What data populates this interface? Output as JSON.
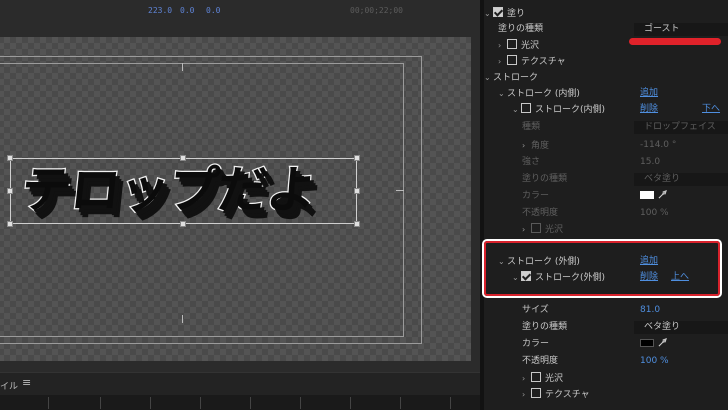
{
  "viewer": {
    "readout": [
      "223.0",
      "0.0",
      "0.0"
    ],
    "timecode": "00;00;22;00"
  },
  "canvas_text": "テロップだよ",
  "bottom": {
    "label": "イル",
    "menu": "≡"
  },
  "panel": {
    "fill_checkbox": "塗り",
    "fill_type_label": "塗りの種類",
    "fill_type_value": "ゴースト",
    "gloss": "光沢",
    "texture": "テクスチャ",
    "stroke_header": "ストローク",
    "inner_stroke_group": "ストローク (内側)",
    "add": "追加",
    "inner_stroke_item": "ストローク(内側)",
    "delete": "削除",
    "move_down": "下へ",
    "type_label": "種類",
    "type_value": "ドロップフェイス",
    "angle_label": "角度",
    "angle_value": "-114.0 °",
    "strength_label": "強さ",
    "strength_value": "15.0",
    "inner_fill_type_label": "塗りの種類",
    "inner_fill_type_value": "ベタ塗り",
    "color_label": "カラー",
    "opacity_label": "不透明度",
    "inner_opacity_value": "100 %",
    "inner_gloss": "光沢",
    "outer_stroke_group": "ストローク (外側)",
    "outer_add": "追加",
    "outer_stroke_item": "ストローク(外側)",
    "outer_delete": "削除",
    "move_up": "上へ",
    "size_label": "サイズ",
    "size_value": "81.0",
    "outer_fill_type_label": "塗りの種類",
    "outer_fill_type_value": "ベタ塗り",
    "outer_color_label": "カラー",
    "outer_opacity_label": "不透明度",
    "outer_opacity_value": "100 %",
    "outer_gloss": "光沢",
    "outer_texture": "テクスチャ"
  },
  "colors": {
    "accent": "#4f8fe0",
    "highlight": "#e0222a",
    "inner_color": "#ffffff",
    "outer_color": "#000000"
  },
  "icons": [
    "chevron-icon",
    "checkbox-icon",
    "eyedropper-icon"
  ]
}
